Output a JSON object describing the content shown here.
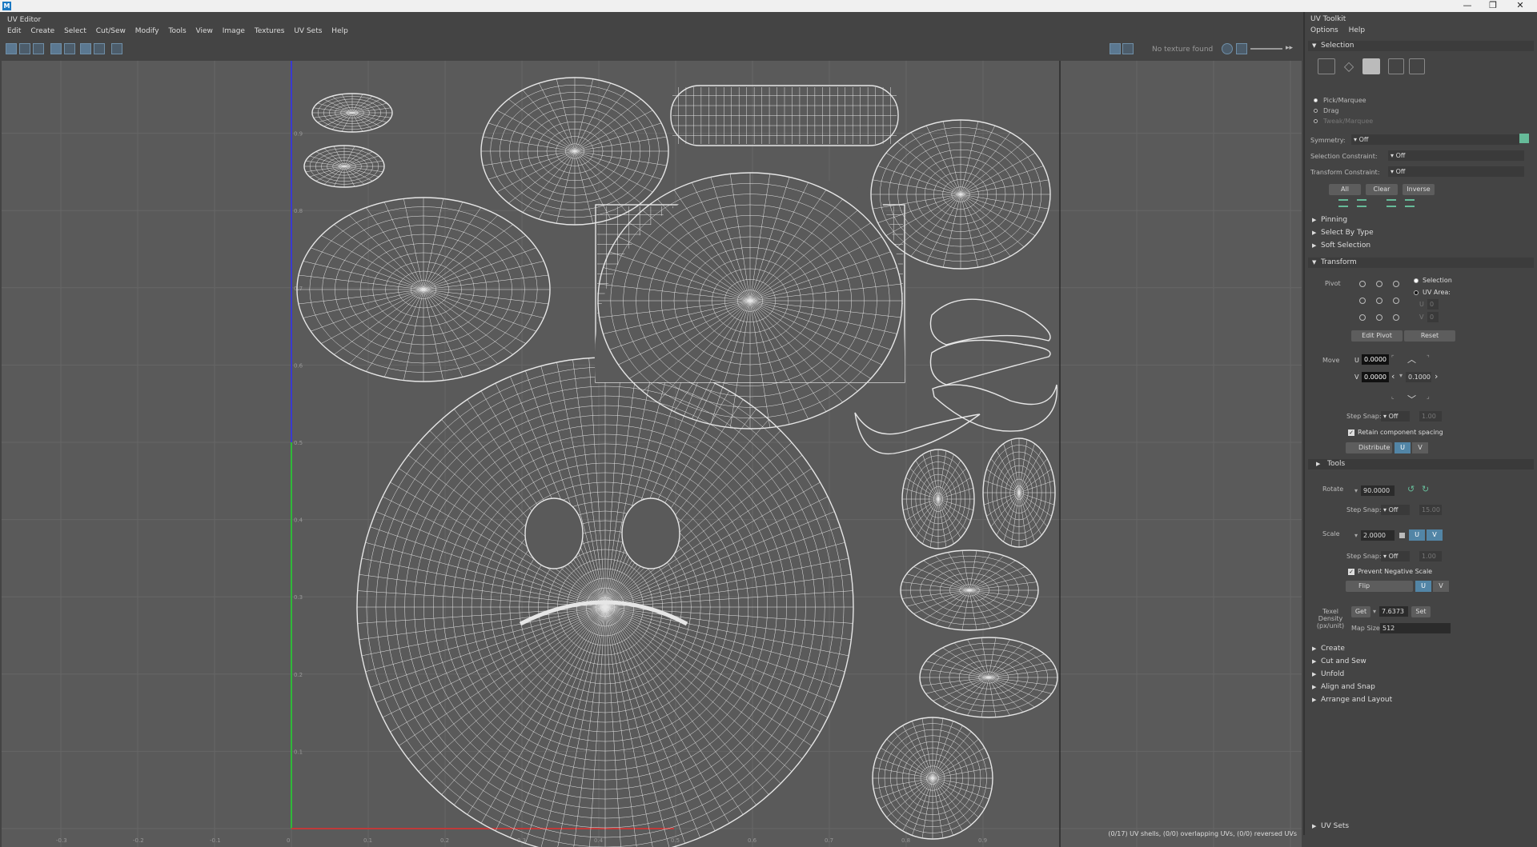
{
  "window": {
    "app_icon": "M",
    "close": "✕",
    "maximize": "❐",
    "minimize": "—"
  },
  "editor": {
    "title": "UV Editor",
    "menu": [
      "Edit",
      "Create",
      "Select",
      "Cut/Sew",
      "Modify",
      "Tools",
      "View",
      "Image",
      "Textures",
      "UV Sets",
      "Help"
    ],
    "no_texture": "No texture found",
    "status": "(0/17) UV shells, (0/0) overlapping UVs, (0/0) reversed UVs",
    "v_ticks": [
      "0.9",
      "0.8",
      "0.7",
      "0.6",
      "0.5",
      "0.4",
      "0.3",
      "0.2",
      "0.1"
    ],
    "u_ticks": [
      "-0.3",
      "-0.2",
      "-0.1",
      "0",
      "0.1",
      "0.2",
      "0.3",
      "0.4",
      "0.5",
      "0.6",
      "0.7",
      "0.8",
      "0.9"
    ]
  },
  "toolkit": {
    "title": "UV Toolkit",
    "menu": [
      "Options",
      "Help"
    ],
    "selection": {
      "header": "Selection",
      "modes": [
        "Pick/Marquee",
        "Drag",
        "Tweak/Marquee"
      ],
      "symmetry_label": "Symmetry:",
      "symmetry_value": "Off",
      "sel_constraint_label": "Selection Constraint:",
      "sel_constraint_value": "Off",
      "xf_constraint_label": "Transform Constraint:",
      "xf_constraint_value": "Off",
      "buttons": [
        "All",
        "Clear",
        "Inverse"
      ]
    },
    "subsections": [
      "Pinning",
      "Select By Type",
      "Soft Selection"
    ],
    "transform": {
      "header": "Transform",
      "pivot_label": "Pivot",
      "pivot_sel": "Selection",
      "pivot_uv": "UV Area:",
      "pivot_u": "U",
      "pivot_v": "V",
      "pivot_u_val": "0",
      "pivot_v_val": "0",
      "edit_pivot": "Edit Pivot",
      "reset": "Reset",
      "move_label": "Move",
      "u_label": "U",
      "v_label": "V",
      "move_u": "0.0000",
      "move_v": "0.0000",
      "move_step": "0.1000",
      "step_snap": "Step Snap:",
      "off": "Off",
      "step_val1": "1.00",
      "retain": "Retain component spacing",
      "distribute": "Distribute",
      "tools": "Tools",
      "rotate_label": "Rotate",
      "rotate_val": "90.0000",
      "rotate_step": "15.00",
      "scale_label": "Scale",
      "scale_val": "2.0000",
      "scale_step": "1.00",
      "prevent_neg": "Prevent Negative Scale",
      "flip": "Flip",
      "td_label": "Texel Density (px/unit)",
      "get": "Get",
      "td_val": "7.6373",
      "set": "Set",
      "map_size_label": "Map Size:",
      "map_size": "512",
      "u": "U",
      "v": "V"
    },
    "bottom_sections": [
      "Create",
      "Cut and Sew",
      "Unfold",
      "Align and Snap",
      "Arrange and Layout"
    ],
    "uv_sets": "UV Sets"
  }
}
